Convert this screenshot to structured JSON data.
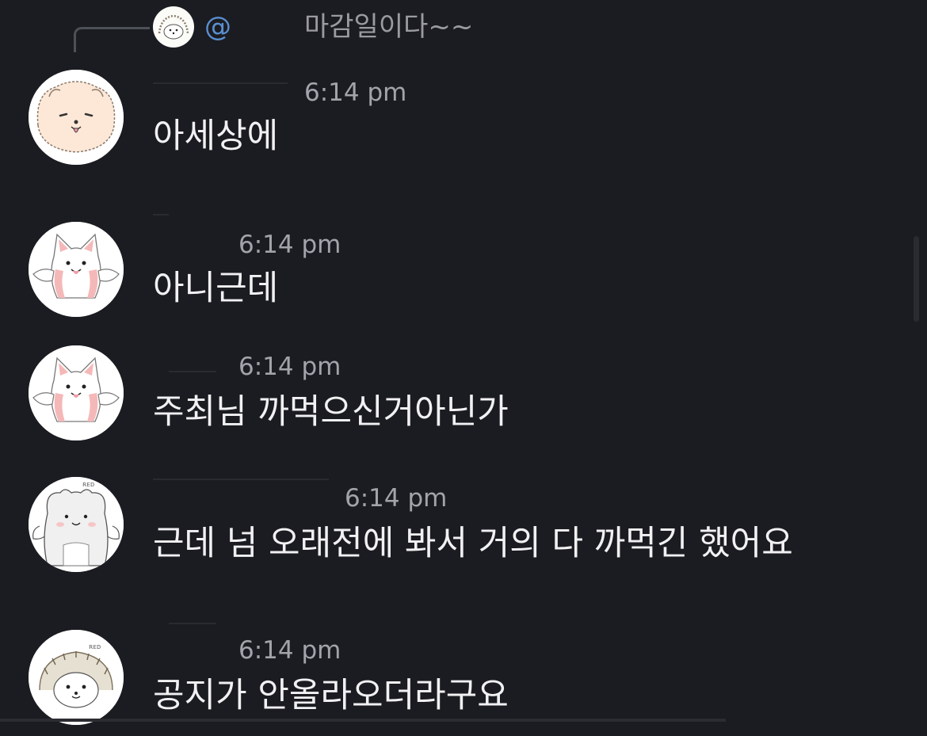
{
  "reply": {
    "mention": "@",
    "text": "마감일이다~~",
    "avatar_icon": "hedgehog-avatar-icon"
  },
  "messages": [
    {
      "time": "6:14 pm",
      "text": "아세상에",
      "avatar_icon": "pomeranian-avatar-icon"
    },
    {
      "time": "6:14 pm",
      "text": "아니근데",
      "avatar_icon": "pink-cat-avatar-icon"
    },
    {
      "time": "6:14 pm",
      "text": "주최님 까먹으신거아닌가",
      "avatar_icon": "pink-cat-avatar-icon"
    },
    {
      "time": "6:14 pm",
      "text": "근데 넘 오래전에 봐서 거의 다 까먹긴 했어요",
      "avatar_icon": "white-bear-avatar-icon"
    },
    {
      "time": "6:14 pm",
      "text": "공지가 안올라오더라구요",
      "avatar_icon": "hedgehog-avatar-icon"
    }
  ],
  "colors": {
    "background": "#1b1c21",
    "message_text": "#f1f1f3",
    "timestamp": "#a2a4ab",
    "mention": "#5a8fd0"
  }
}
